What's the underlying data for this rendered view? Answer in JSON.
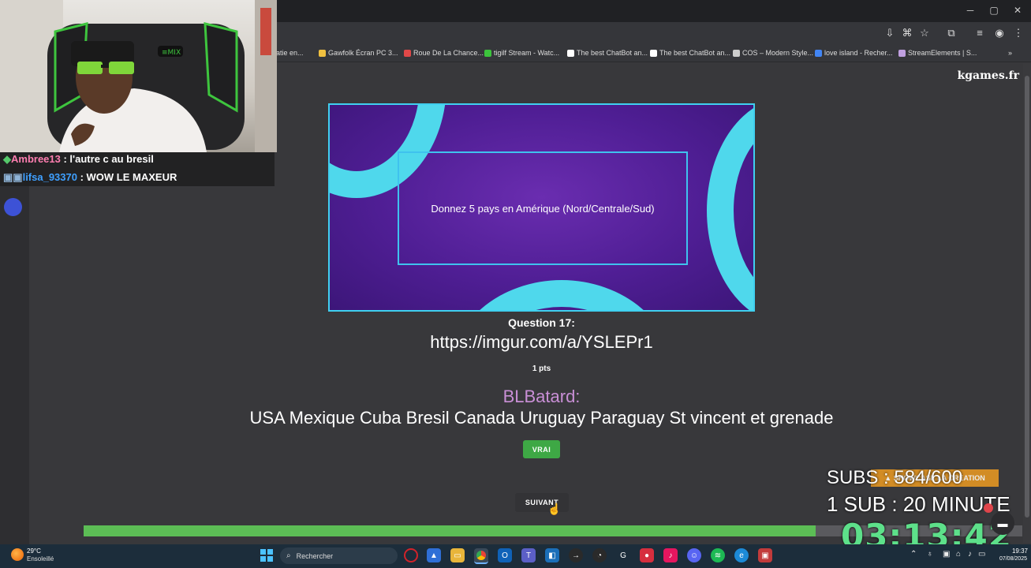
{
  "browser": {
    "bookmarks": [
      {
        "label": "roatie en...",
        "color": "#888888"
      },
      {
        "label": "Gawfolk Écran PC 3...",
        "color": "#f0c040"
      },
      {
        "label": "Roue De La Chance...",
        "color": "#e04848"
      },
      {
        "label": "tigilf Stream - Watc...",
        "color": "#3cc43c"
      },
      {
        "label": "The best ChatBot an...",
        "color": "#ffffff"
      },
      {
        "label": "The best ChatBot an...",
        "color": "#ffffff"
      },
      {
        "label": "COS – Modern Style...",
        "color": "#cccccc"
      },
      {
        "label": "love island - Recher...",
        "color": "#4285f4"
      },
      {
        "label": "StreamElements | S...",
        "color": "#c0a0e0"
      }
    ],
    "more_bookmarks": "»"
  },
  "stream_chat": [
    {
      "user": "Ambree13",
      "user_color": "#ff7eb0",
      "message": " : l'autre c au bresil"
    },
    {
      "user": "lifsa_93370",
      "user_color": "#3fa0ff",
      "message": " : WOW LE MAXEUR"
    }
  ],
  "page": {
    "brand": "kgames.fr",
    "quiz_prompt": "Donnez 5 pays en Amérique (Nord/Centrale/Sud)",
    "question_number": "Question 17:",
    "question_link": "https://imgur.com/a/YSLEPr1",
    "points": "1 pts",
    "player_name": "BLBatard:",
    "player_answer": "USA Mexique Cuba Bresil Canada Uruguay Paraguay St vincent et grenade",
    "vrai_button": "VRAI",
    "next_button": "SUIVANT",
    "progress_fraction": 0.78
  },
  "overlay": {
    "subs_badge": "▲ SHOWCASE LA CREATION",
    "subs_count": "SUBS : 584/600",
    "sub_rule": "1 SUB : 20 MINUTE",
    "timer": "03:13:42"
  },
  "taskbar": {
    "temperature": "29°C",
    "weather": "Ensoleillé",
    "search_placeholder": "Rechercher",
    "time": "19:37",
    "date": "07/08/2025"
  }
}
